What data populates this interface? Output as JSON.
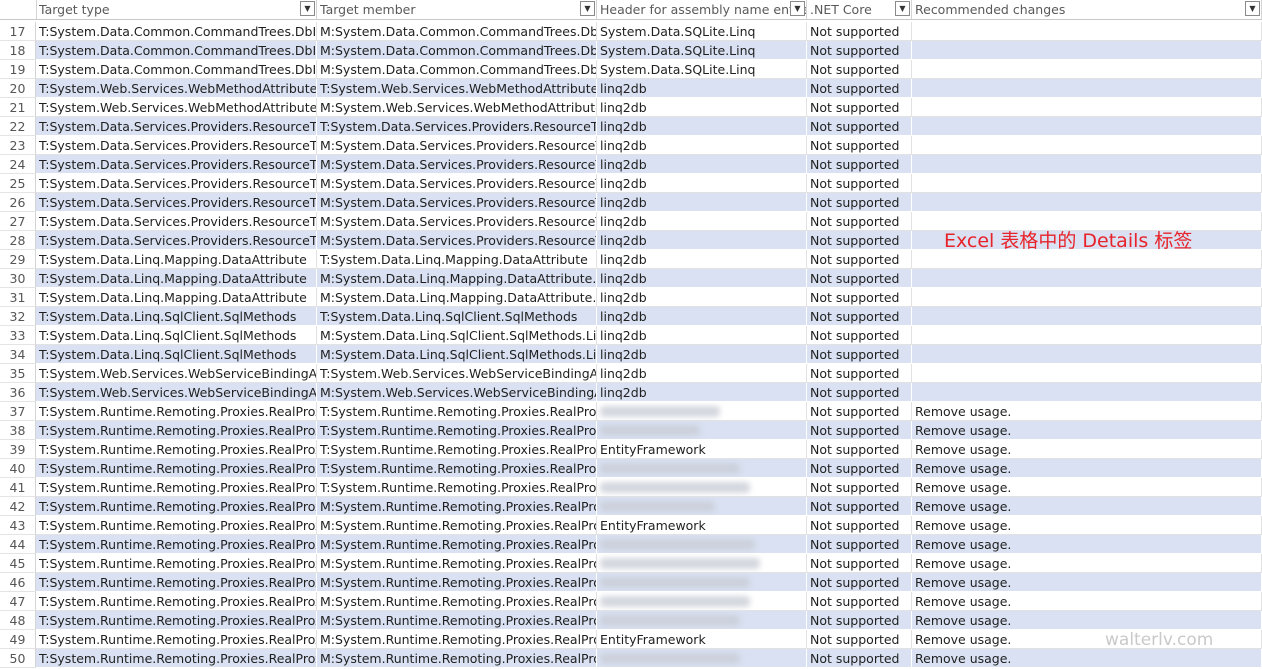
{
  "headers": [
    {
      "label": "Target type"
    },
    {
      "label": "Target member"
    },
    {
      "label": "Header for assembly name entries"
    },
    {
      "label": ".NET Core"
    },
    {
      "label": "Recommended changes"
    }
  ],
  "filter_icon": "chevron-down-icon",
  "colors": {
    "band": "#d9e1f2",
    "annotation": "#e8232a"
  },
  "annotation": "Excel 表格中的 Details 标签",
  "watermark": "walterlv.com",
  "rows": [
    {
      "num": "17",
      "type": "T:System.Data.Common.CommandTrees.DbInsertCommandTree",
      "member": "M:System.Data.Common.CommandTrees.DbInsertCommandTree",
      "assembly": "System.Data.SQLite.Linq",
      "core": "Not supported",
      "rec": ""
    },
    {
      "num": "18",
      "type": "T:System.Data.Common.CommandTrees.DbInsertCommandTree",
      "member": "M:System.Data.Common.CommandTrees.DbInsertCommandTree",
      "assembly": "System.Data.SQLite.Linq",
      "core": "Not supported",
      "rec": ""
    },
    {
      "num": "19",
      "type": "T:System.Data.Common.CommandTrees.DbInsertCommandTree",
      "member": "M:System.Data.Common.CommandTrees.DbInsertCommandTree",
      "assembly": "System.Data.SQLite.Linq",
      "core": "Not supported",
      "rec": ""
    },
    {
      "num": "20",
      "type": "T:System.Web.Services.WebMethodAttribute",
      "member": "T:System.Web.Services.WebMethodAttribute",
      "assembly": "linq2db",
      "core": "Not supported",
      "rec": ""
    },
    {
      "num": "21",
      "type": "T:System.Web.Services.WebMethodAttribute",
      "member": "M:System.Web.Services.WebMethodAttribute.#ctor",
      "assembly": "linq2db",
      "core": "Not supported",
      "rec": ""
    },
    {
      "num": "22",
      "type": "T:System.Data.Services.Providers.ResourceType",
      "member": "T:System.Data.Services.Providers.ResourceType",
      "assembly": "linq2db",
      "core": "Not supported",
      "rec": ""
    },
    {
      "num": "23",
      "type": "T:System.Data.Services.Providers.ResourceType",
      "member": "M:System.Data.Services.Providers.ResourceType.",
      "assembly": "linq2db",
      "core": "Not supported",
      "rec": ""
    },
    {
      "num": "24",
      "type": "T:System.Data.Services.Providers.ResourceType",
      "member": "M:System.Data.Services.Providers.ResourceType.",
      "assembly": "linq2db",
      "core": "Not supported",
      "rec": ""
    },
    {
      "num": "25",
      "type": "T:System.Data.Services.Providers.ResourceType",
      "member": "M:System.Data.Services.Providers.ResourceType.",
      "assembly": "linq2db",
      "core": "Not supported",
      "rec": ""
    },
    {
      "num": "26",
      "type": "T:System.Data.Services.Providers.ResourceType",
      "member": "M:System.Data.Services.Providers.ResourceType.",
      "assembly": "linq2db",
      "core": "Not supported",
      "rec": ""
    },
    {
      "num": "27",
      "type": "T:System.Data.Services.Providers.ResourceType",
      "member": "M:System.Data.Services.Providers.ResourceType.",
      "assembly": "linq2db",
      "core": "Not supported",
      "rec": ""
    },
    {
      "num": "28",
      "type": "T:System.Data.Services.Providers.ResourceType",
      "member": "M:System.Data.Services.Providers.ResourceType.",
      "assembly": "linq2db",
      "core": "Not supported",
      "rec": ""
    },
    {
      "num": "29",
      "type": "T:System.Data.Linq.Mapping.DataAttribute",
      "member": "T:System.Data.Linq.Mapping.DataAttribute",
      "assembly": "linq2db",
      "core": "Not supported",
      "rec": ""
    },
    {
      "num": "30",
      "type": "T:System.Data.Linq.Mapping.DataAttribute",
      "member": "M:System.Data.Linq.Mapping.DataAttribute.get_",
      "assembly": "linq2db",
      "core": "Not supported",
      "rec": ""
    },
    {
      "num": "31",
      "type": "T:System.Data.Linq.Mapping.DataAttribute",
      "member": "M:System.Data.Linq.Mapping.DataAttribute.get_",
      "assembly": "linq2db",
      "core": "Not supported",
      "rec": ""
    },
    {
      "num": "32",
      "type": "T:System.Data.Linq.SqlClient.SqlMethods",
      "member": "T:System.Data.Linq.SqlClient.SqlMethods",
      "assembly": "linq2db",
      "core": "Not supported",
      "rec": ""
    },
    {
      "num": "33",
      "type": "T:System.Data.Linq.SqlClient.SqlMethods",
      "member": "M:System.Data.Linq.SqlClient.SqlMethods.Like(System.String)",
      "assembly": "linq2db",
      "core": "Not supported",
      "rec": ""
    },
    {
      "num": "34",
      "type": "T:System.Data.Linq.SqlClient.SqlMethods",
      "member": "M:System.Data.Linq.SqlClient.SqlMethods.Like(System.String)",
      "assembly": "linq2db",
      "core": "Not supported",
      "rec": ""
    },
    {
      "num": "35",
      "type": "T:System.Web.Services.WebServiceBindingAttribute",
      "member": "T:System.Web.Services.WebServiceBindingAttribute",
      "assembly": "linq2db",
      "core": "Not supported",
      "rec": ""
    },
    {
      "num": "36",
      "type": "T:System.Web.Services.WebServiceBindingAttribute",
      "member": "M:System.Web.Services.WebServiceBindingAttribute",
      "assembly": "linq2db",
      "core": "Not supported",
      "rec": ""
    },
    {
      "num": "37",
      "type": "T:System.Runtime.Remoting.Proxies.RealProxy",
      "member": "T:System.Runtime.Remoting.Proxies.RealProxy",
      "assembly": "",
      "core": "Not supported",
      "rec": "Remove usage."
    },
    {
      "num": "38",
      "type": "T:System.Runtime.Remoting.Proxies.RealProxy",
      "member": "T:System.Runtime.Remoting.Proxies.RealProxy",
      "assembly": "",
      "core": "Not supported",
      "rec": "Remove usage."
    },
    {
      "num": "39",
      "type": "T:System.Runtime.Remoting.Proxies.RealProxy",
      "member": "T:System.Runtime.Remoting.Proxies.RealProxy",
      "assembly": "EntityFramework",
      "core": "Not supported",
      "rec": "Remove usage."
    },
    {
      "num": "40",
      "type": "T:System.Runtime.Remoting.Proxies.RealProxy",
      "member": "T:System.Runtime.Remoting.Proxies.RealProxy",
      "assembly": "",
      "core": "Not supported",
      "rec": "Remove usage."
    },
    {
      "num": "41",
      "type": "T:System.Runtime.Remoting.Proxies.RealProxy",
      "member": "T:System.Runtime.Remoting.Proxies.RealProxy",
      "assembly": "",
      "core": "Not supported",
      "rec": "Remove usage."
    },
    {
      "num": "42",
      "type": "T:System.Runtime.Remoting.Proxies.RealProxy",
      "member": "M:System.Runtime.Remoting.Proxies.RealProxy.#ctor",
      "assembly": "",
      "core": "Not supported",
      "rec": "Remove usage."
    },
    {
      "num": "43",
      "type": "T:System.Runtime.Remoting.Proxies.RealProxy",
      "member": "M:System.Runtime.Remoting.Proxies.RealProxy.#ctor",
      "assembly": "EntityFramework",
      "core": "Not supported",
      "rec": "Remove usage."
    },
    {
      "num": "44",
      "type": "T:System.Runtime.Remoting.Proxies.RealProxy",
      "member": "M:System.Runtime.Remoting.Proxies.RealProxy.AttachServer",
      "assembly": "",
      "core": "Not supported",
      "rec": "Remove usage."
    },
    {
      "num": "45",
      "type": "T:System.Runtime.Remoting.Proxies.RealProxy",
      "member": "M:System.Runtime.Remoting.Proxies.RealProxy.DetachServer",
      "assembly": "",
      "core": "Not supported",
      "rec": "Remove usage."
    },
    {
      "num": "46",
      "type": "T:System.Runtime.Remoting.Proxies.RealProxy",
      "member": "M:System.Runtime.Remoting.Proxies.RealProxy.CreateObjRef",
      "assembly": "",
      "core": "Not supported",
      "rec": "Remove usage."
    },
    {
      "num": "47",
      "type": "T:System.Runtime.Remoting.Proxies.RealProxy",
      "member": "M:System.Runtime.Remoting.Proxies.RealProxy.GetTransparentProxy",
      "assembly": "",
      "core": "Not supported",
      "rec": "Remove usage."
    },
    {
      "num": "48",
      "type": "T:System.Runtime.Remoting.Proxies.RealProxy",
      "member": "M:System.Runtime.Remoting.Proxies.RealProxy.GetTransparentProxy",
      "assembly": "",
      "core": "Not supported",
      "rec": "Remove usage."
    },
    {
      "num": "49",
      "type": "T:System.Runtime.Remoting.Proxies.RealProxy",
      "member": "M:System.Runtime.Remoting.Proxies.RealProxy.GetTransparentProxy",
      "assembly": "EntityFramework",
      "core": "Not supported",
      "rec": "Remove usage."
    },
    {
      "num": "50",
      "type": "T:System.Runtime.Remoting.Proxies.RealProxy",
      "member": "M:System.Runtime.Remoting.Proxies.RealProxy.GetTransparentProxy",
      "assembly": "",
      "core": "Not supported",
      "rec": "Remove usage."
    }
  ]
}
